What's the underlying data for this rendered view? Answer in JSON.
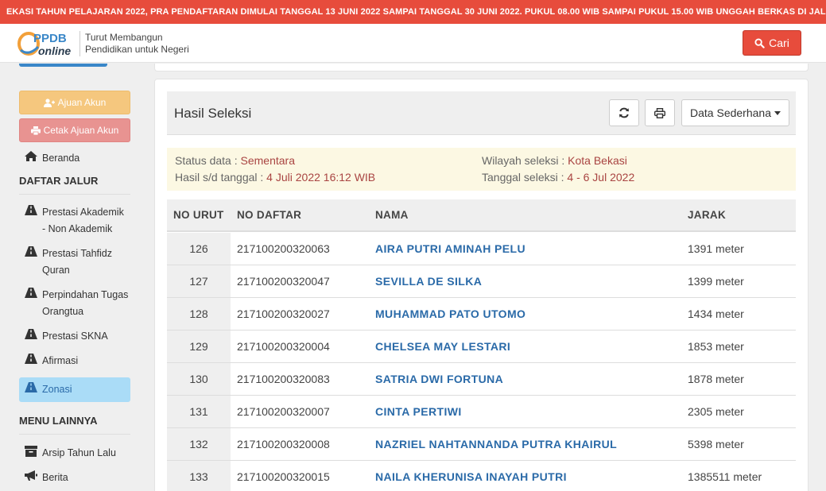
{
  "marquee": {
    "text": "EKASI TAHUN PELAJARAN 2022, PRA PENDAFTARAN DIMULAI TANGGAL 13 JUNI 2022 SAMPAI TANGGAL 30 JUNI 2022. PUKUL 08.00 WIB SAMPAI PUKUL 15.00 WIB UNGGAH BERKAS DI JALUR AFI"
  },
  "header": {
    "logo_text_top": "PPDB",
    "logo_text_bottom": "online",
    "tagline_line1": "Turut Membangun",
    "tagline_line2": "Pendidikan untuk Negeri",
    "search_button": "Cari"
  },
  "sidebar": {
    "ajuan_akun": "Ajuan Akun",
    "cetak_ajuan_akun": "Cetak Ajuan Akun",
    "beranda": "Beranda",
    "daftar_jalur_heading": "DAFTAR JALUR",
    "jalur": [
      {
        "line1": "Prestasi Akademik",
        "line2": "- Non Akademik"
      },
      {
        "line1": "Prestasi Tahfidz",
        "line2": "Quran"
      },
      {
        "line1": "Perpindahan Tugas",
        "line2": "Orangtua"
      },
      {
        "line1": "Prestasi SKNA"
      },
      {
        "line1": "Afirmasi"
      },
      {
        "line1": "Zonasi"
      }
    ],
    "menu_lainnya_heading": "MENU LAINNYA",
    "arsip": "Arsip Tahun Lalu",
    "berita": "Berita"
  },
  "card": {
    "title": "Hasil Seleksi",
    "dropdown_label": "Data Sederhana"
  },
  "info": {
    "status_label": "Status data : ",
    "status_value": "Sementara",
    "hasil_label": "Hasil s/d tanggal : ",
    "hasil_value": "4 Juli 2022 16:12 WIB",
    "wilayah_label": "Wilayah seleksi : ",
    "wilayah_value": "Kota Bekasi",
    "tanggal_label": "Tanggal seleksi : ",
    "tanggal_value": "4 - 6 Jul 2022"
  },
  "table": {
    "headers": {
      "no_urut": "NO URUT",
      "no_daftar": "NO DAFTAR",
      "nama": "NAMA",
      "jarak": "JARAK"
    },
    "rows": [
      {
        "no": "126",
        "daftar": "217100200320063",
        "nama": "AIRA PUTRI AMINAH PELU",
        "jarak": "1391 meter"
      },
      {
        "no": "127",
        "daftar": "217100200320047",
        "nama": "SEVILLA DE SILKA",
        "jarak": "1399 meter"
      },
      {
        "no": "128",
        "daftar": "217100200320027",
        "nama": "MUHAMMAD PATO UTOMO",
        "jarak": "1434 meter"
      },
      {
        "no": "129",
        "daftar": "217100200320004",
        "nama": "CHELSEA MAY LESTARI",
        "jarak": "1853 meter"
      },
      {
        "no": "130",
        "daftar": "217100200320083",
        "nama": "SATRIA DWI FORTUNA",
        "jarak": "1878 meter"
      },
      {
        "no": "131",
        "daftar": "217100200320007",
        "nama": "CINTA PERTIWI",
        "jarak": "2305 meter"
      },
      {
        "no": "132",
        "daftar": "217100200320008",
        "nama": "NAZRIEL NAHTANNANDA PUTRA KHAIRUL",
        "jarak": "5398 meter"
      },
      {
        "no": "133",
        "daftar": "217100200320015",
        "nama": "NAILA KHERUNISA INAYAH PUTRI",
        "jarak": "1385511 meter"
      }
    ]
  },
  "colors": {
    "accent_red": "#e74c3c",
    "link_blue": "#2a6aa8",
    "active_blue": "#aadcf7",
    "info_bg": "#fcf8e3"
  },
  "icons": [
    "search-icon",
    "user-plus-icon",
    "print-icon",
    "home-icon",
    "road-icon",
    "refresh-icon",
    "archive-icon",
    "bullhorn-icon",
    "caret-down-icon"
  ]
}
